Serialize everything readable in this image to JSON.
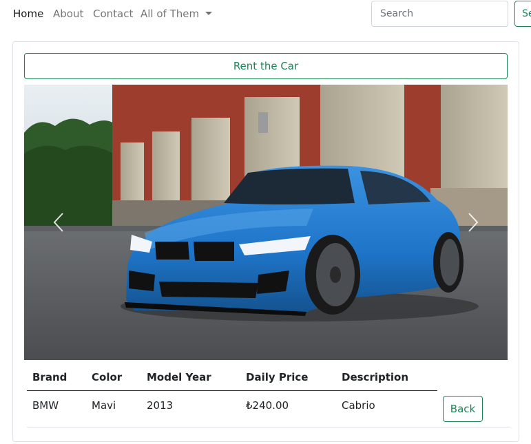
{
  "navbar": {
    "links": [
      "Home",
      "About",
      "Contact"
    ],
    "dropdown_label": "All of Them",
    "search_placeholder": "Search",
    "search_button_label": "Search"
  },
  "page": {
    "rent_button_label": "Rent the Car",
    "back_button_label": "Back"
  },
  "carousel": {
    "image_subject": "blue BMW coupe parked in front of a brick building",
    "prev_icon": "chevron-left-icon",
    "next_icon": "chevron-right-icon"
  },
  "table": {
    "headers": [
      "Brand",
      "Color",
      "Model Year",
      "Daily Price",
      "Description"
    ],
    "row": [
      "BMW",
      "Mavi",
      "2013",
      "₺240.00",
      "Cabrio"
    ]
  },
  "colors": {
    "accent": "#198754",
    "car": "#1e74c8",
    "brick": "#a3402f"
  }
}
